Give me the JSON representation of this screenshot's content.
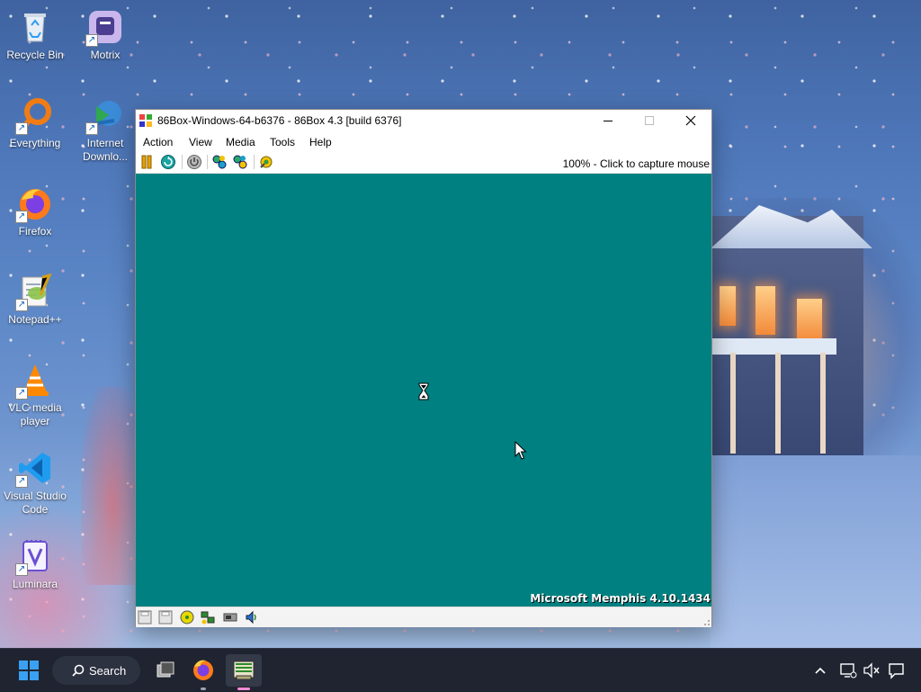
{
  "desktop": {
    "icons": [
      {
        "label": "Recycle Bin"
      },
      {
        "label": "Motrix"
      },
      {
        "label": "Everything"
      },
      {
        "label": "Internet Downlo..."
      },
      {
        "label": "Firefox"
      },
      {
        "label": "Notepad++"
      },
      {
        "label": "VLC media player"
      },
      {
        "label": "Visual Studio Code"
      },
      {
        "label": "Luminara"
      }
    ]
  },
  "window": {
    "title": "86Box-Windows-64-b6376 - 86Box 4.3 [build 6376]",
    "menu": [
      "Action",
      "View",
      "Media",
      "Tools",
      "Help"
    ],
    "toolbar_status": "100% - Click to capture mouse",
    "screen": {
      "background": "#008080",
      "os_banner": "Microsoft Memphis 4.10.1434"
    }
  },
  "taskbar": {
    "search_label": "Search",
    "colors": {
      "accent": "#ff8ad8"
    }
  },
  "icons": {
    "window": [
      "minimize-icon",
      "maximize-icon",
      "close-icon"
    ],
    "toolbar": [
      "pause-icon",
      "hard-reset-icon",
      "power-icon",
      "ctrl-alt-del-icon",
      "ctrl-alt-esc-icon",
      "settings-icon"
    ],
    "statusbar": [
      "floppy-a-icon",
      "floppy-b-icon",
      "cdrom-icon",
      "network-icon",
      "hdd-icon",
      "sound-icon"
    ],
    "taskbar": [
      "start-icon",
      "search-icon",
      "task-view-icon",
      "firefox-icon",
      "86box-icon",
      "chevron-up-icon",
      "network-disconnected-icon",
      "volume-muted-icon",
      "notifications-icon"
    ]
  }
}
